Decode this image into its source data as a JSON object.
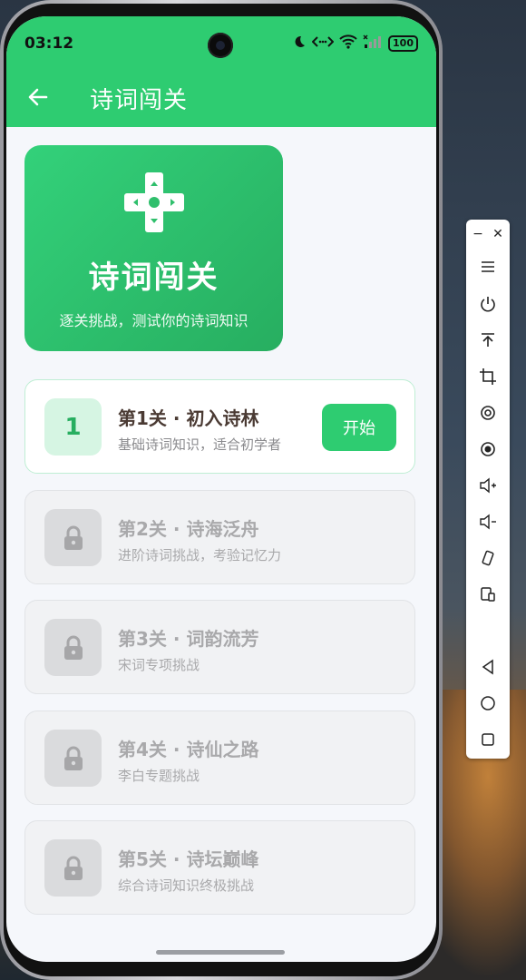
{
  "status_bar": {
    "time": "03:12",
    "battery": "100",
    "icons": [
      "moon-icon",
      "link-icon",
      "wifi-icon",
      "signal-icon",
      "battery-icon"
    ]
  },
  "app_bar": {
    "title": "诗词闯关",
    "back_icon": "arrow-left-icon"
  },
  "hero": {
    "icon": "gamepad-dpad-icon",
    "title": "诗词闯关",
    "subtitle": "逐关挑战，测试你的诗词知识"
  },
  "levels": [
    {
      "number": "1",
      "title": "第1关 · 初入诗林",
      "desc": "基础诗词知识，适合初学者",
      "locked": false,
      "button": "开始"
    },
    {
      "title": "第2关 · 诗海泛舟",
      "desc": "进阶诗词挑战，考验记忆力",
      "locked": true
    },
    {
      "title": "第3关 · 词韵流芳",
      "desc": "宋词专项挑战",
      "locked": true
    },
    {
      "title": "第4关 · 诗仙之路",
      "desc": "李白专题挑战",
      "locked": true
    },
    {
      "title": "第5关 · 诗坛巅峰",
      "desc": "综合诗词知识终极挑战",
      "locked": true
    }
  ],
  "colors": {
    "primary": "#2ecc71",
    "primary_dark": "#27ae60",
    "locked_bg": "#f1f2f4",
    "text_dark": "#4a3a33",
    "text_muted": "#a9a9ab"
  },
  "toolbar": {
    "buttons": [
      "minimize-icon",
      "close-icon",
      "menu-icon",
      "power-icon",
      "upload-icon",
      "crop-icon",
      "target-icon",
      "record-icon",
      "volume-up-icon",
      "volume-down-icon",
      "rotate-icon",
      "screenshot-icon",
      "back-icon",
      "home-icon",
      "overview-icon"
    ]
  }
}
